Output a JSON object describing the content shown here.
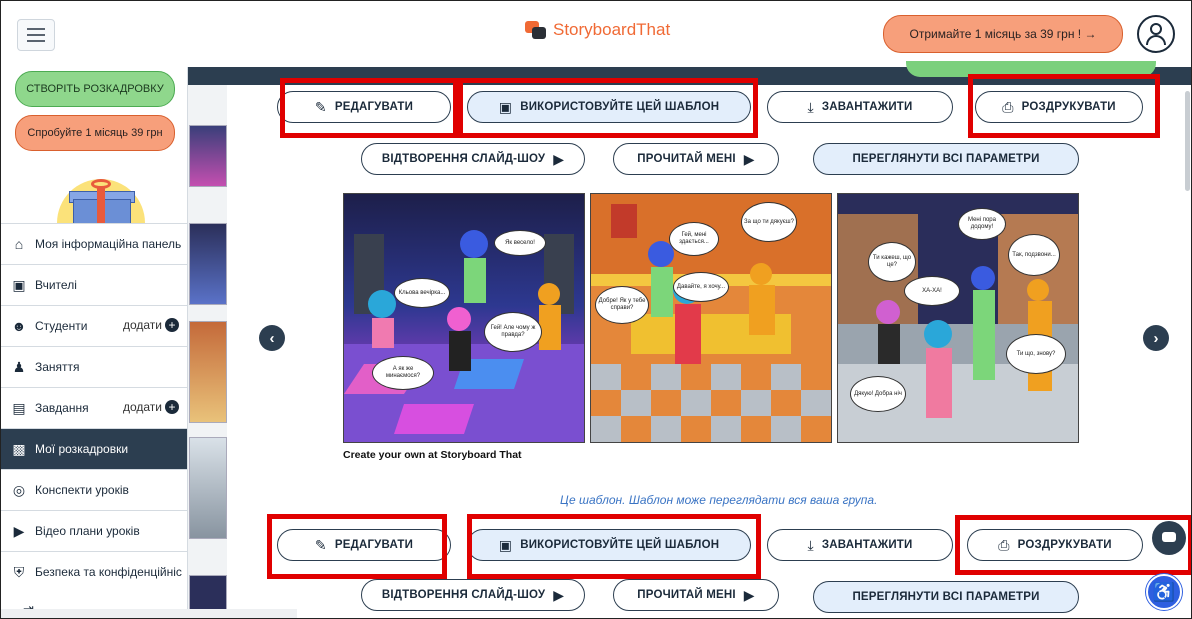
{
  "header": {
    "logo_text": "StoryboardThat",
    "promo_label": "Отримайте 1 місяць за 39 грн ! →"
  },
  "sidebar": {
    "create_label": "СТВОРІТЬ РОЗКАДРОВКУ",
    "trial_label": "Спробуйте 1 місяць 39 грн",
    "items": [
      {
        "label": "Моя інформаційна панель",
        "icon": "home-icon"
      },
      {
        "label": "Вчителі",
        "icon": "teacher-icon"
      },
      {
        "label": "Студенти",
        "icon": "students-icon",
        "add": "додати"
      },
      {
        "label": "Заняття",
        "icon": "classes-icon"
      },
      {
        "label": "Завдання",
        "icon": "assignment-icon",
        "add": "додати"
      },
      {
        "label": "Мої розкадровки",
        "icon": "storyboards-icon",
        "active": true
      },
      {
        "label": "Конспекти уроків",
        "icon": "lesson-plans-icon"
      },
      {
        "label": "Відео плани уроків",
        "icon": "video-icon"
      },
      {
        "label": "Безпека та конфіденційніс",
        "icon": "shield-icon"
      }
    ]
  },
  "actions": {
    "edit": "РЕДАГУВАТИ",
    "use_template": "ВИКОРИСТОВУЙТЕ ЦЕЙ ШАБЛОН",
    "download": "ЗАВАНТАЖИТИ",
    "print": "РОЗДРУКУВАТИ",
    "slideshow": "ВІДТВОРЕННЯ СЛАЙД-ШОУ",
    "read_to_me": "ПРОЧИТАЙ МЕНІ",
    "all_options": "ПЕРЕГЛЯНУТИ ВСІ ПАРАМЕТРИ"
  },
  "storyboard": {
    "caption": "Create your own at Storyboard That",
    "template_note": "Це шаблон. Шаблон може переглядати вся ваша група."
  },
  "colors": {
    "highlight": "#e00000",
    "nav_active": "#2c3e50",
    "create_green": "#8fd78c",
    "promo_orange": "#f79f7b",
    "pill_blue": "#e3eefb"
  }
}
